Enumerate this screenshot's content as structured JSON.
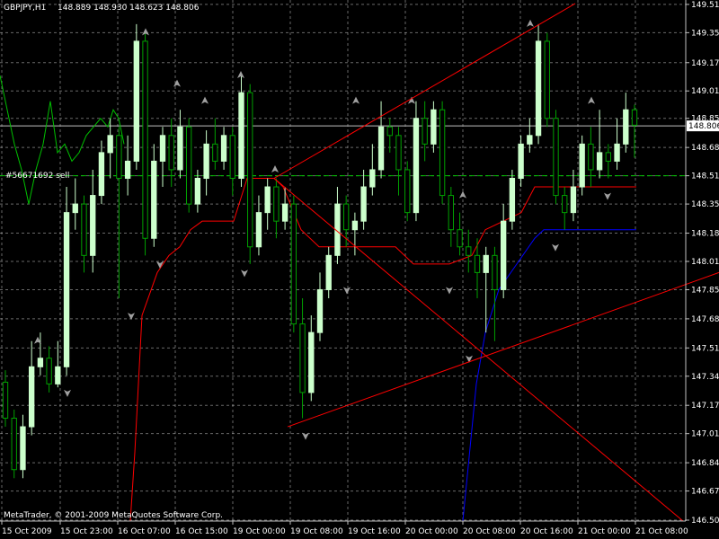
{
  "header": {
    "symbol": "GBPJPY,H1",
    "ohlc": "148.889 148.930 148.623 148.806"
  },
  "order_label": "#56671692 sell",
  "footer": {
    "copyright": "MetaTrader, © 2001-2009 MetaQuotes Software Corp."
  },
  "colors": {
    "background": "#000000",
    "grid": "#c0c0c0",
    "bull": "#ccffcc",
    "bear": "#00a000",
    "red": "#ff0000",
    "blue": "#0000ff",
    "green": "#00c000",
    "arrows": "#a0a0a0"
  },
  "chart_data": {
    "type": "candlestick",
    "y_range": [
      146.505,
      149.525
    ],
    "y_ticks": [
      "149.515",
      "149.350",
      "149.175",
      "149.010",
      "148.850",
      "148.680",
      "148.515",
      "148.350",
      "148.180",
      "148.015",
      "147.850",
      "147.680",
      "147.510",
      "147.345",
      "147.175",
      "147.010",
      "146.840",
      "146.675",
      "146.505"
    ],
    "x_ticks": [
      "15 Oct 2009",
      "15 Oct 23:00",
      "16 Oct 07:00",
      "16 Oct 15:00",
      "19 Oct 00:00",
      "19 Oct 08:00",
      "19 Oct 16:00",
      "20 Oct 00:00",
      "20 Oct 08:00",
      "20 Oct 16:00",
      "21 Oct 00:00",
      "21 Oct 08:00"
    ],
    "current_price": "148.806",
    "order_price": 148.515,
    "candle_series": [
      [
        147.31,
        147.1,
        147.38,
        147.05
      ],
      [
        147.1,
        146.8,
        147.15,
        146.75
      ],
      [
        146.8,
        147.05,
        147.12,
        146.75
      ],
      [
        147.05,
        147.4,
        147.55,
        147.0
      ],
      [
        147.4,
        147.45,
        147.6,
        147.35
      ],
      [
        147.45,
        147.3,
        147.52,
        147.25
      ],
      [
        147.3,
        147.4,
        147.55,
        147.28
      ],
      [
        147.4,
        148.3,
        148.45,
        147.35
      ],
      [
        148.3,
        148.35,
        148.5,
        148.2
      ],
      [
        148.35,
        148.05,
        148.4,
        147.95
      ],
      [
        148.05,
        148.4,
        148.55,
        147.95
      ],
      [
        148.4,
        148.65,
        148.72,
        148.35
      ],
      [
        148.65,
        148.75,
        148.85,
        148.5
      ],
      [
        148.75,
        148.5,
        148.8,
        147.8
      ],
      [
        148.5,
        148.6,
        148.75,
        148.4
      ],
      [
        148.6,
        149.3,
        149.4,
        148.55
      ],
      [
        149.3,
        148.15,
        149.35,
        148.05
      ],
      [
        148.15,
        148.6,
        148.7,
        148.1
      ],
      [
        148.6,
        148.75,
        148.8,
        148.45
      ],
      [
        148.75,
        148.55,
        148.85,
        148.45
      ],
      [
        148.55,
        148.8,
        148.9,
        148.5
      ],
      [
        148.8,
        148.35,
        148.85,
        148.3
      ],
      [
        148.35,
        148.5,
        148.55,
        148.3
      ],
      [
        148.5,
        148.7,
        148.78,
        148.4
      ],
      [
        148.7,
        148.6,
        148.85,
        148.55
      ],
      [
        148.6,
        148.75,
        148.8,
        148.55
      ],
      [
        148.75,
        148.5,
        148.8,
        148.4
      ],
      [
        148.5,
        149.0,
        149.1,
        148.45
      ],
      [
        149.0,
        148.1,
        149.05,
        148.0
      ],
      [
        148.1,
        148.3,
        148.4,
        148.05
      ],
      [
        148.3,
        148.45,
        148.5,
        148.2
      ],
      [
        148.45,
        148.25,
        148.5,
        148.15
      ],
      [
        148.25,
        148.35,
        148.45,
        148.2
      ],
      [
        148.35,
        147.65,
        148.4,
        147.6
      ],
      [
        147.65,
        147.25,
        147.8,
        147.1
      ],
      [
        147.25,
        147.6,
        147.7,
        147.2
      ],
      [
        147.6,
        147.85,
        147.95,
        147.55
      ],
      [
        147.85,
        148.05,
        148.1,
        147.8
      ],
      [
        148.05,
        148.35,
        148.45,
        148.0
      ],
      [
        148.35,
        148.2,
        148.4,
        148.1
      ],
      [
        148.2,
        148.25,
        148.3,
        148.05
      ],
      [
        148.25,
        148.45,
        148.55,
        148.2
      ],
      [
        148.45,
        148.55,
        148.7,
        148.4
      ],
      [
        148.55,
        148.8,
        148.95,
        148.5
      ],
      [
        148.8,
        148.75,
        148.85,
        148.65
      ],
      [
        148.75,
        148.55,
        148.8,
        148.4
      ],
      [
        148.55,
        148.3,
        148.6,
        148.25
      ],
      [
        148.3,
        148.85,
        148.95,
        148.25
      ],
      [
        148.85,
        148.7,
        148.95,
        148.6
      ],
      [
        148.7,
        148.9,
        148.95,
        148.65
      ],
      [
        148.9,
        148.4,
        148.95,
        148.35
      ],
      [
        148.4,
        148.2,
        148.45,
        148.1
      ],
      [
        148.2,
        148.1,
        148.3,
        148.05
      ],
      [
        148.1,
        148.05,
        148.2,
        147.95
      ],
      [
        148.05,
        147.95,
        148.15,
        147.8
      ],
      [
        147.95,
        148.05,
        148.1,
        147.6
      ],
      [
        148.05,
        147.85,
        148.1,
        147.55
      ],
      [
        147.85,
        148.25,
        148.35,
        147.8
      ],
      [
        148.25,
        148.5,
        148.55,
        148.2
      ],
      [
        148.5,
        148.7,
        148.75,
        148.45
      ],
      [
        148.7,
        148.75,
        148.85,
        148.65
      ],
      [
        148.75,
        149.3,
        149.4,
        148.7
      ],
      [
        149.3,
        148.85,
        149.35,
        148.8
      ],
      [
        148.85,
        148.4,
        148.9,
        148.35
      ],
      [
        148.4,
        148.3,
        148.45,
        148.2
      ],
      [
        148.3,
        148.45,
        148.55,
        148.25
      ],
      [
        148.45,
        148.7,
        148.75,
        148.4
      ],
      [
        148.7,
        148.55,
        148.8,
        148.45
      ],
      [
        148.55,
        148.65,
        148.9,
        148.5
      ],
      [
        148.65,
        148.6,
        148.7,
        148.5
      ],
      [
        148.6,
        148.7,
        148.85,
        148.55
      ],
      [
        148.7,
        148.9,
        149.0,
        148.65
      ],
      [
        148.9,
        148.81,
        148.93,
        148.62
      ]
    ],
    "indicators": {
      "green_line": [
        [
          0,
          149.1
        ],
        [
          8,
          148.9
        ],
        [
          16,
          148.7
        ],
        [
          24,
          148.55
        ],
        [
          32,
          148.35
        ],
        [
          40,
          148.55
        ],
        [
          48,
          148.7
        ],
        [
          56,
          148.95
        ],
        [
          64,
          148.65
        ],
        [
          72,
          148.7
        ],
        [
          80,
          148.6
        ],
        [
          88,
          148.65
        ],
        [
          96,
          148.75
        ],
        [
          104,
          148.8
        ],
        [
          112,
          148.85
        ],
        [
          120,
          148.8
        ],
        [
          126,
          148.9
        ],
        [
          132,
          148.85
        ],
        [
          138,
          148.7
        ]
      ],
      "red_step": [
        [
          145,
          146.5
        ],
        [
          150,
          146.9
        ],
        [
          158,
          147.7
        ],
        [
          175,
          147.95
        ],
        [
          188,
          148.05
        ],
        [
          200,
          148.1
        ],
        [
          212,
          148.2
        ],
        [
          225,
          148.25
        ],
        [
          260,
          148.25
        ],
        [
          275,
          148.5
        ],
        [
          305,
          148.5
        ],
        [
          315,
          148.45
        ],
        [
          335,
          148.2
        ],
        [
          355,
          148.1
        ],
        [
          390,
          148.1
        ],
        [
          440,
          148.1
        ],
        [
          460,
          148.0
        ],
        [
          500,
          148.0
        ],
        [
          525,
          148.05
        ],
        [
          540,
          148.2
        ],
        [
          580,
          148.3
        ],
        [
          595,
          148.45
        ],
        [
          708,
          148.45
        ]
      ],
      "blue_line": [
        [
          515,
          146.5
        ],
        [
          530,
          147.3
        ],
        [
          540,
          147.6
        ],
        [
          555,
          147.85
        ],
        [
          575,
          148.0
        ],
        [
          595,
          148.15
        ],
        [
          605,
          148.2
        ],
        [
          708,
          148.2
        ]
      ]
    },
    "trendlines": [
      {
        "name": "upper",
        "from": [
          305,
          148.5
        ],
        "to": [
          640,
          149.52
        ]
      },
      {
        "name": "diag-down",
        "from": [
          305,
          148.5
        ],
        "to": [
          760,
          146.5
        ]
      },
      {
        "name": "lower",
        "from": [
          320,
          147.05
        ],
        "to": [
          800,
          147.95
        ]
      }
    ],
    "arrows": {
      "up": [
        [
          42,
          147.55
        ],
        [
          162,
          149.35
        ],
        [
          197,
          149.05
        ],
        [
          228,
          148.95
        ],
        [
          268,
          149.1
        ],
        [
          306,
          148.55
        ],
        [
          396,
          148.95
        ],
        [
          458,
          148.95
        ],
        [
          515,
          148.4
        ],
        [
          590,
          149.4
        ],
        [
          658,
          148.95
        ]
      ],
      "down": [
        [
          75,
          147.25
        ],
        [
          146,
          147.7
        ],
        [
          178,
          148.0
        ],
        [
          272,
          147.95
        ],
        [
          340,
          147.0
        ],
        [
          386,
          147.85
        ],
        [
          500,
          147.85
        ],
        [
          522,
          147.45
        ],
        [
          618,
          148.1
        ],
        [
          676,
          148.4
        ]
      ]
    }
  }
}
